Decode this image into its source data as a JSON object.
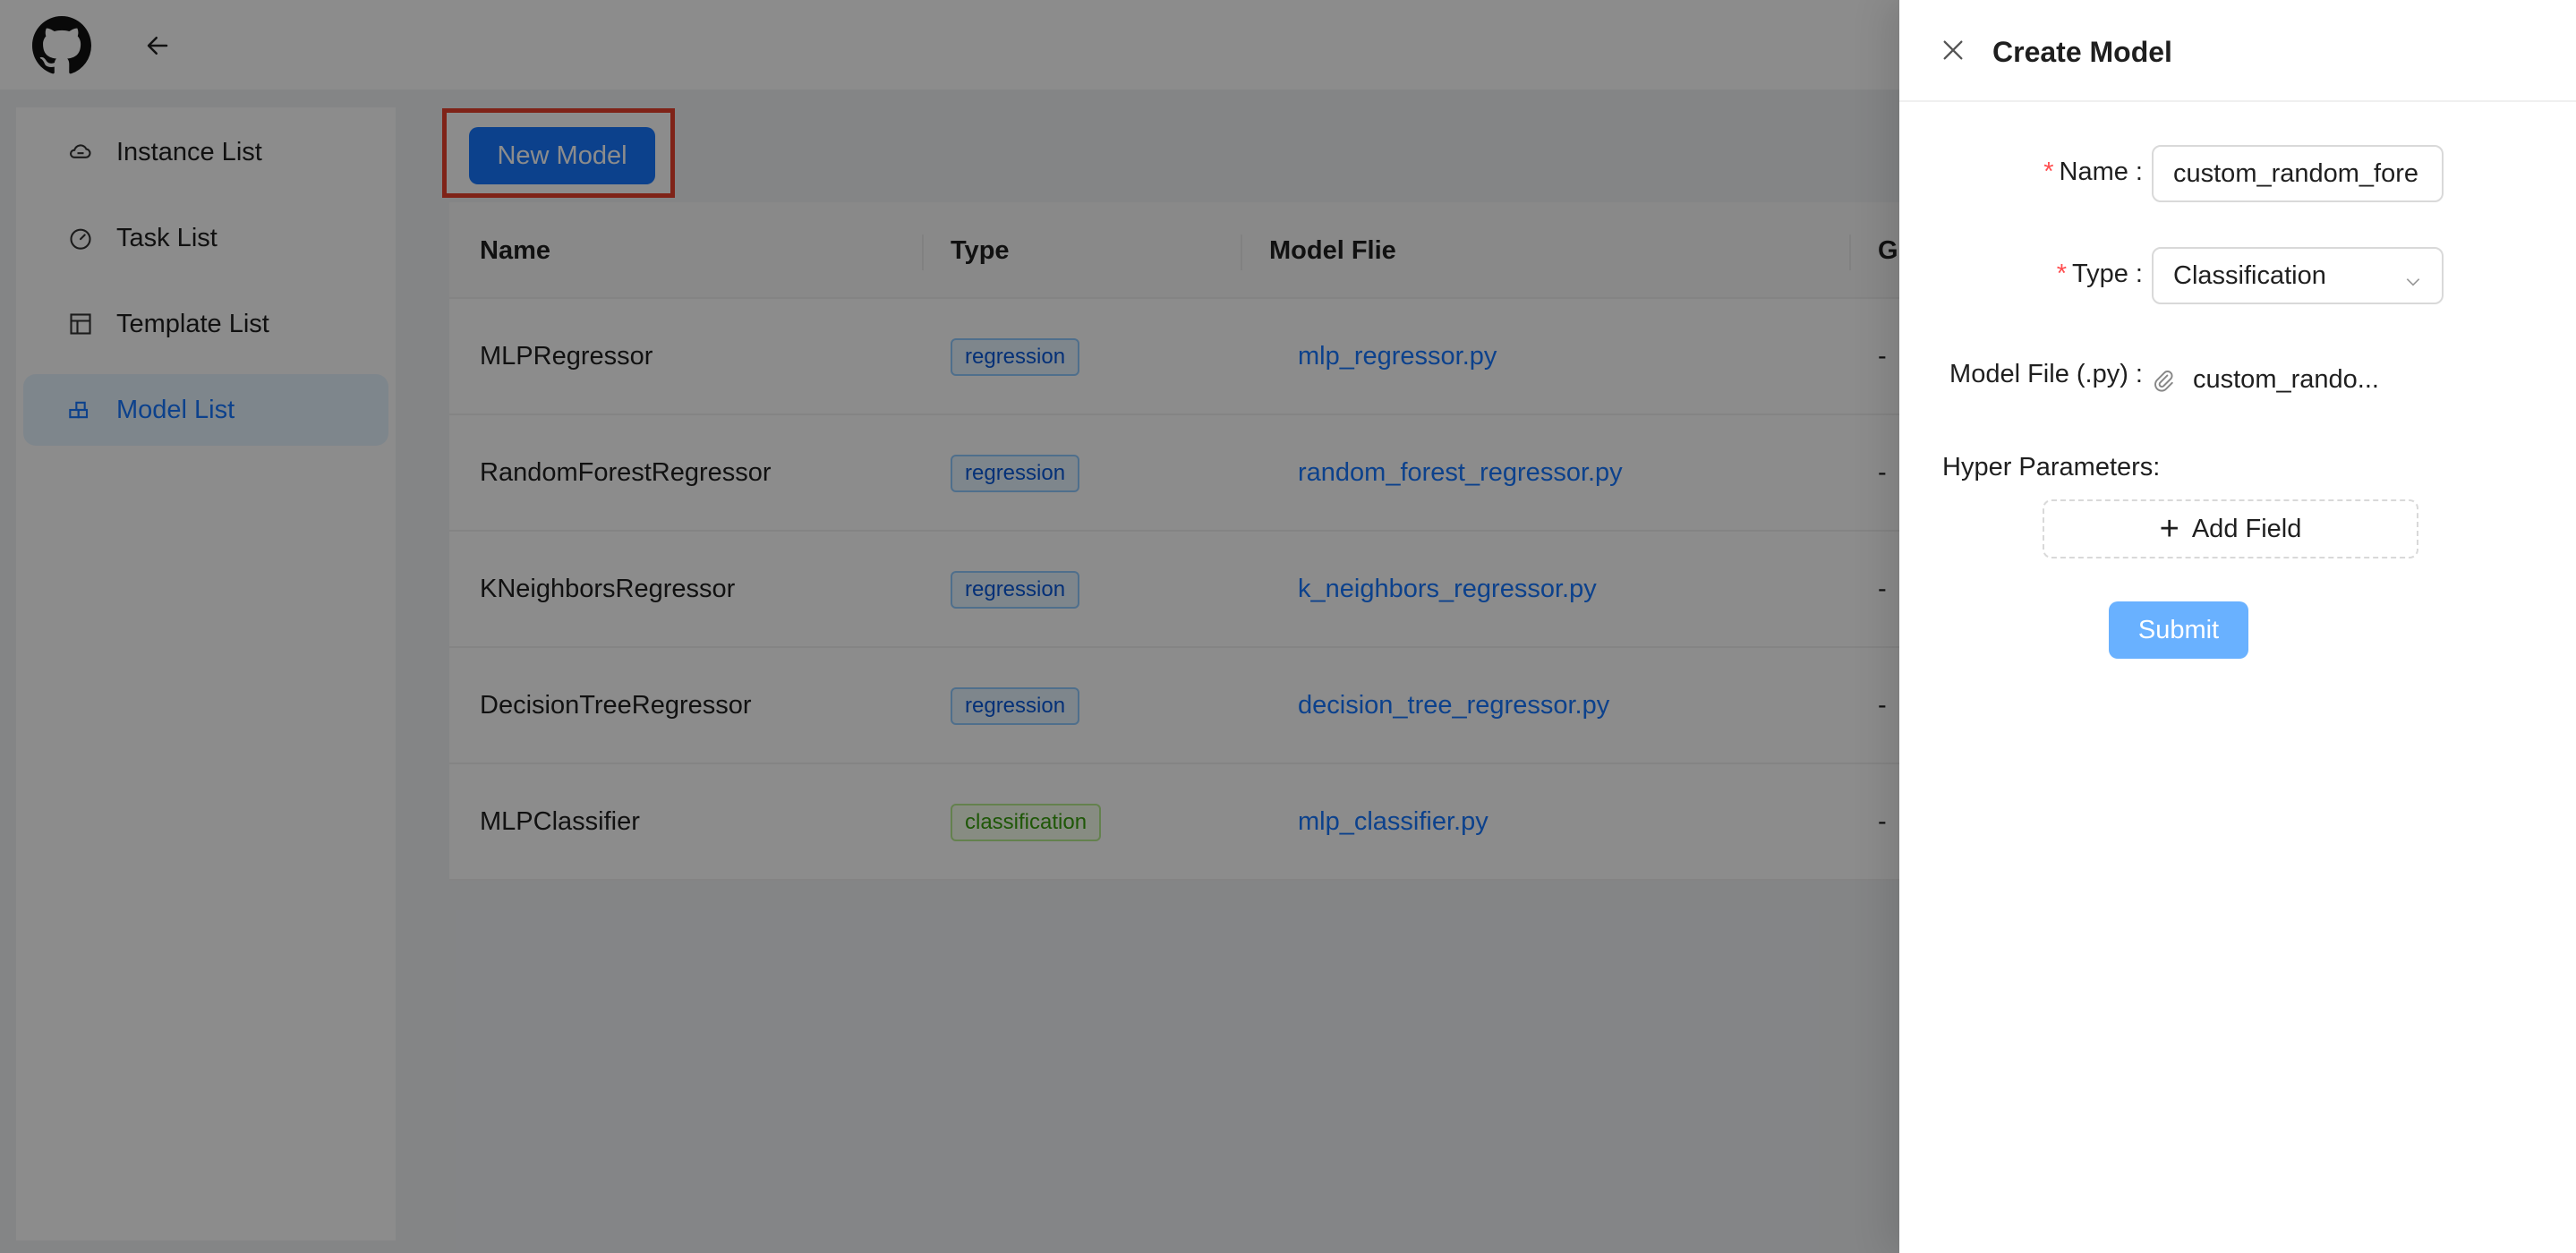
{
  "sidebar": {
    "items": [
      {
        "label": "Instance List",
        "icon": "cloud-icon"
      },
      {
        "label": "Task List",
        "icon": "dashboard-icon"
      },
      {
        "label": "Template List",
        "icon": "layout-icon"
      },
      {
        "label": "Model List",
        "icon": "blocks-icon"
      }
    ],
    "active_index": 3
  },
  "toolbar": {
    "new_model_label": "New Model"
  },
  "table": {
    "headers": [
      "Name",
      "Type",
      "Model Flie",
      "Gi"
    ],
    "rows": [
      {
        "name": "MLPRegressor",
        "type": "regression",
        "file": "mlp_regressor.py",
        "extra": "-"
      },
      {
        "name": "RandomForestRegressor",
        "type": "regression",
        "file": "random_forest_regressor.py",
        "extra": "-"
      },
      {
        "name": "KNeighborsRegressor",
        "type": "regression",
        "file": "k_neighbors_regressor.py",
        "extra": "-"
      },
      {
        "name": "DecisionTreeRegressor",
        "type": "regression",
        "file": "decision_tree_regressor.py",
        "extra": "-"
      },
      {
        "name": "MLPClassifier",
        "type": "classification",
        "file": "mlp_classifier.py",
        "extra": "-"
      }
    ]
  },
  "drawer": {
    "title": "Create Model",
    "form": {
      "name_label": "Name",
      "name_value": "custom_random_fore",
      "type_label": "Type",
      "type_value": "Classification",
      "model_file_label": "Model File (.py)",
      "model_file_value": "custom_rando...",
      "hyper_params_label": "Hyper Parameters:",
      "add_field_label": "Add Field",
      "submit_label": "Submit"
    }
  },
  "colors": {
    "primary": "#1677ff",
    "highlight": "#e8412c",
    "required": "#ff4d4f"
  }
}
